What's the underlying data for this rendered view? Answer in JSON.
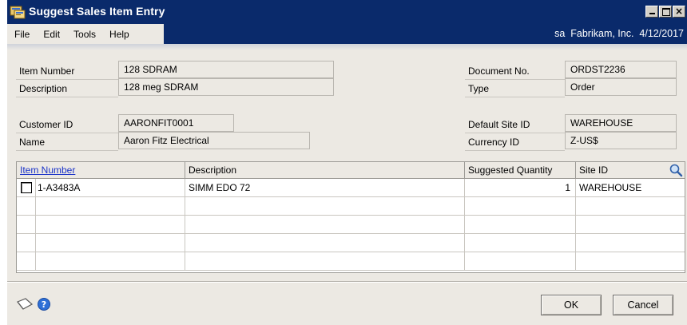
{
  "window": {
    "title": "Suggest Sales Item Entry",
    "controls": {
      "minimize": "▁",
      "maximize": "□",
      "close": "×"
    }
  },
  "menu": {
    "items": [
      "File",
      "Edit",
      "Tools",
      "Help"
    ],
    "company_info": "sa  Fabrikam, Inc.  4/12/2017"
  },
  "header": {
    "item_number_label": "Item Number",
    "item_number": "128 SDRAM",
    "description_label": "Description",
    "description": "128 meg SDRAM",
    "document_no_label": "Document No.",
    "document_no": "ORDST2236",
    "type_label": "Type",
    "type": "Order",
    "customer_id_label": "Customer ID",
    "customer_id": "AARONFIT0001",
    "name_label": "Name",
    "name": "Aaron Fitz Electrical",
    "default_site_label": "Default Site ID",
    "default_site": "WAREHOUSE",
    "currency_label": "Currency ID",
    "currency": "Z-US$"
  },
  "grid": {
    "columns": {
      "item_number": "Item Number",
      "description": "Description",
      "suggested_quantity": "Suggested Quantity",
      "site_id": "Site ID"
    },
    "rows": [
      {
        "item_number": "1-A3483A",
        "description": "SIMM EDO 72",
        "suggested_quantity": "1",
        "site_id": "WAREHOUSE"
      },
      {
        "item_number": "",
        "description": "",
        "suggested_quantity": "",
        "site_id": ""
      },
      {
        "item_number": "",
        "description": "",
        "suggested_quantity": "",
        "site_id": ""
      },
      {
        "item_number": "",
        "description": "",
        "suggested_quantity": "",
        "site_id": ""
      },
      {
        "item_number": "",
        "description": "",
        "suggested_quantity": "",
        "site_id": ""
      }
    ]
  },
  "buttons": {
    "ok": "OK",
    "cancel": "Cancel"
  },
  "icons": {
    "app": "app-window-icon",
    "lookup": "magnifier-icon",
    "note": "note-icon",
    "help": "help-icon"
  },
  "colors": {
    "title_bar": "#0a2a6b",
    "window_bg": "#ece9e3",
    "link": "#1a33c8"
  }
}
